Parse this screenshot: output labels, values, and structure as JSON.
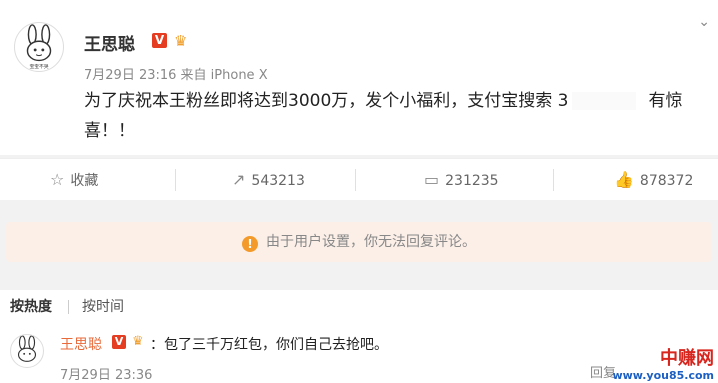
{
  "post": {
    "author": "王思聪",
    "verified_badge": "V",
    "meta": "7月29日 23:16 来自 iPhone X",
    "content_before": "为了庆祝本王粉丝即将达到3000万，发个小福利，支付宝搜索 3",
    "content_after": "有惊喜！！",
    "avatar_caption": "宝宝不哭"
  },
  "actions": {
    "favorite_label": "收藏",
    "repost_count": "543213",
    "comment_count": "231235",
    "like_count": "878372"
  },
  "notice": {
    "icon": "!",
    "text": "由于用户设置，你无法回复评论。"
  },
  "sort": {
    "hot": "按热度",
    "time": "按时间"
  },
  "comment": {
    "author": "王思聪",
    "verified_badge": "V",
    "text": "：包了三千万红包，你们自己去抢吧。",
    "time": "7月29日 23:36",
    "reply_label": "回复"
  },
  "watermark": {
    "site_name": "中赚网",
    "site_url": "www.you85.com"
  },
  "colors": {
    "brand_orange": "#e86a3a",
    "verified_red": "#e43d22",
    "notice_bg": "#fbefe8",
    "warn_orange": "#f39a2b"
  }
}
